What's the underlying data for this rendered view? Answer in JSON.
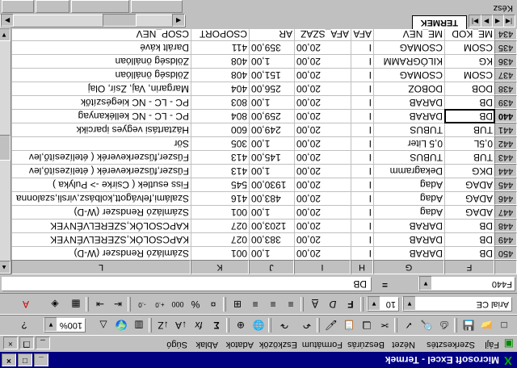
{
  "titlebar": {
    "title": "Microsoft Excel - Termek"
  },
  "menu": [
    "Fájl",
    "Szerkesztés",
    "Nézet",
    "Beszúrás",
    "Formátum",
    "Eszközök",
    "Adatok",
    "Ablak",
    "Súgó"
  ],
  "toolbar": {
    "zoom": "100%",
    "font_name": "Arial CE",
    "font_size": "10",
    "bold": "F",
    "italic": "D",
    "underline": "A",
    "thousands": "000"
  },
  "formula_bar": {
    "name_box": "F440",
    "fx": "=",
    "content": "DB"
  },
  "columns": [
    "F",
    "G",
    "H",
    "I",
    "J",
    "K",
    "L"
  ],
  "headers_row": {
    "row": "434",
    "cells": [
      "ME_KOD",
      "ME_NEV",
      "AFA",
      "AFA_SZAZ",
      "AR",
      "CSOPORT",
      "CSOP_NEV"
    ]
  },
  "rows": [
    {
      "row": "450",
      "cells": [
        "DB",
        "DARAB",
        "I",
        "20,00",
        "1,00",
        "001",
        "Számlázó Rendszer (W-D)"
      ]
    },
    {
      "row": "449",
      "cells": [
        "DB",
        "DARAB",
        "I",
        "20,00",
        "383,00",
        "027",
        "KAPCSOLÓK,SZERELVÉNYEK"
      ]
    },
    {
      "row": "448",
      "cells": [
        "DB",
        "DARAB",
        "I",
        "20,00",
        "1203,00",
        "027",
        "KAPCSOLÓK,SZERELVÉNYEK"
      ]
    },
    {
      "row": "447",
      "cells": [
        "ADAG",
        "Adag",
        "I",
        "20,00",
        "1,00",
        "001",
        "Számlázó Rendszer (W-D)"
      ]
    },
    {
      "row": "446",
      "cells": [
        "ADAG",
        "Adag",
        "I",
        "20,00",
        "483,00",
        "416",
        "Szalámi,felvágott,kolbász,virsli,szalonna"
      ]
    },
    {
      "row": "445",
      "cells": [
        "ADAG",
        "Adag",
        "I",
        "20,00",
        "1930,00",
        "545",
        "Fiss esutlek ( Csirke -> Pulyka )"
      ]
    },
    {
      "row": "444",
      "cells": [
        "DKG",
        "Dekagramm",
        "I",
        "20,00",
        "1,00",
        "413",
        "Fűszer,fűszerkeverék ( ételízesítő,lev"
      ]
    },
    {
      "row": "443",
      "cells": [
        "TUB",
        "TUBUS",
        "I",
        "20,00",
        "145,00",
        "413",
        "Fűszer,fűszerkeverék ( ételízesítő,lev"
      ]
    },
    {
      "row": "442",
      "cells": [
        "0,5L",
        "0,5 Liter",
        "I",
        "20,00",
        "1,00",
        "305",
        "Sör"
      ]
    },
    {
      "row": "441",
      "cells": [
        "TUB",
        "TUBUS",
        "I",
        "20,00",
        "249,00",
        "600",
        "Háztartási vegyes iparcikk"
      ]
    },
    {
      "row": "440",
      "cells": [
        "DB",
        "DARAB",
        "I",
        "20,00",
        "259,00",
        "804",
        "PC - LC - NC kellékanyag"
      ]
    },
    {
      "row": "439",
      "cells": [
        "DB",
        "DARAB",
        "I",
        "20,00",
        "1,00",
        "803",
        "PC - LC - NC kiegészítők"
      ]
    },
    {
      "row": "438",
      "cells": [
        "DOB",
        "DOBOZ",
        "I",
        "20,00",
        "256,00",
        "404",
        "Margarin, Vaj, Zsír, Olaj"
      ]
    },
    {
      "row": "437",
      "cells": [
        "CSOM",
        "CSOMAG",
        "I",
        "20,00",
        "151,00",
        "408",
        "Zöldség önállóan"
      ]
    },
    {
      "row": "436",
      "cells": [
        "KG",
        "KILÓGRAMM",
        "I",
        "20,00",
        "1,00",
        "408",
        "Zöldség önállóan"
      ]
    },
    {
      "row": "435",
      "cells": [
        "CSOM",
        "CSOMAG",
        "I",
        "20,00",
        "359,00",
        "411",
        "Darált kávé"
      ]
    }
  ],
  "active": {
    "row": "440",
    "col": "F"
  },
  "sheet_tab": "TERMEK",
  "status": "Kész"
}
